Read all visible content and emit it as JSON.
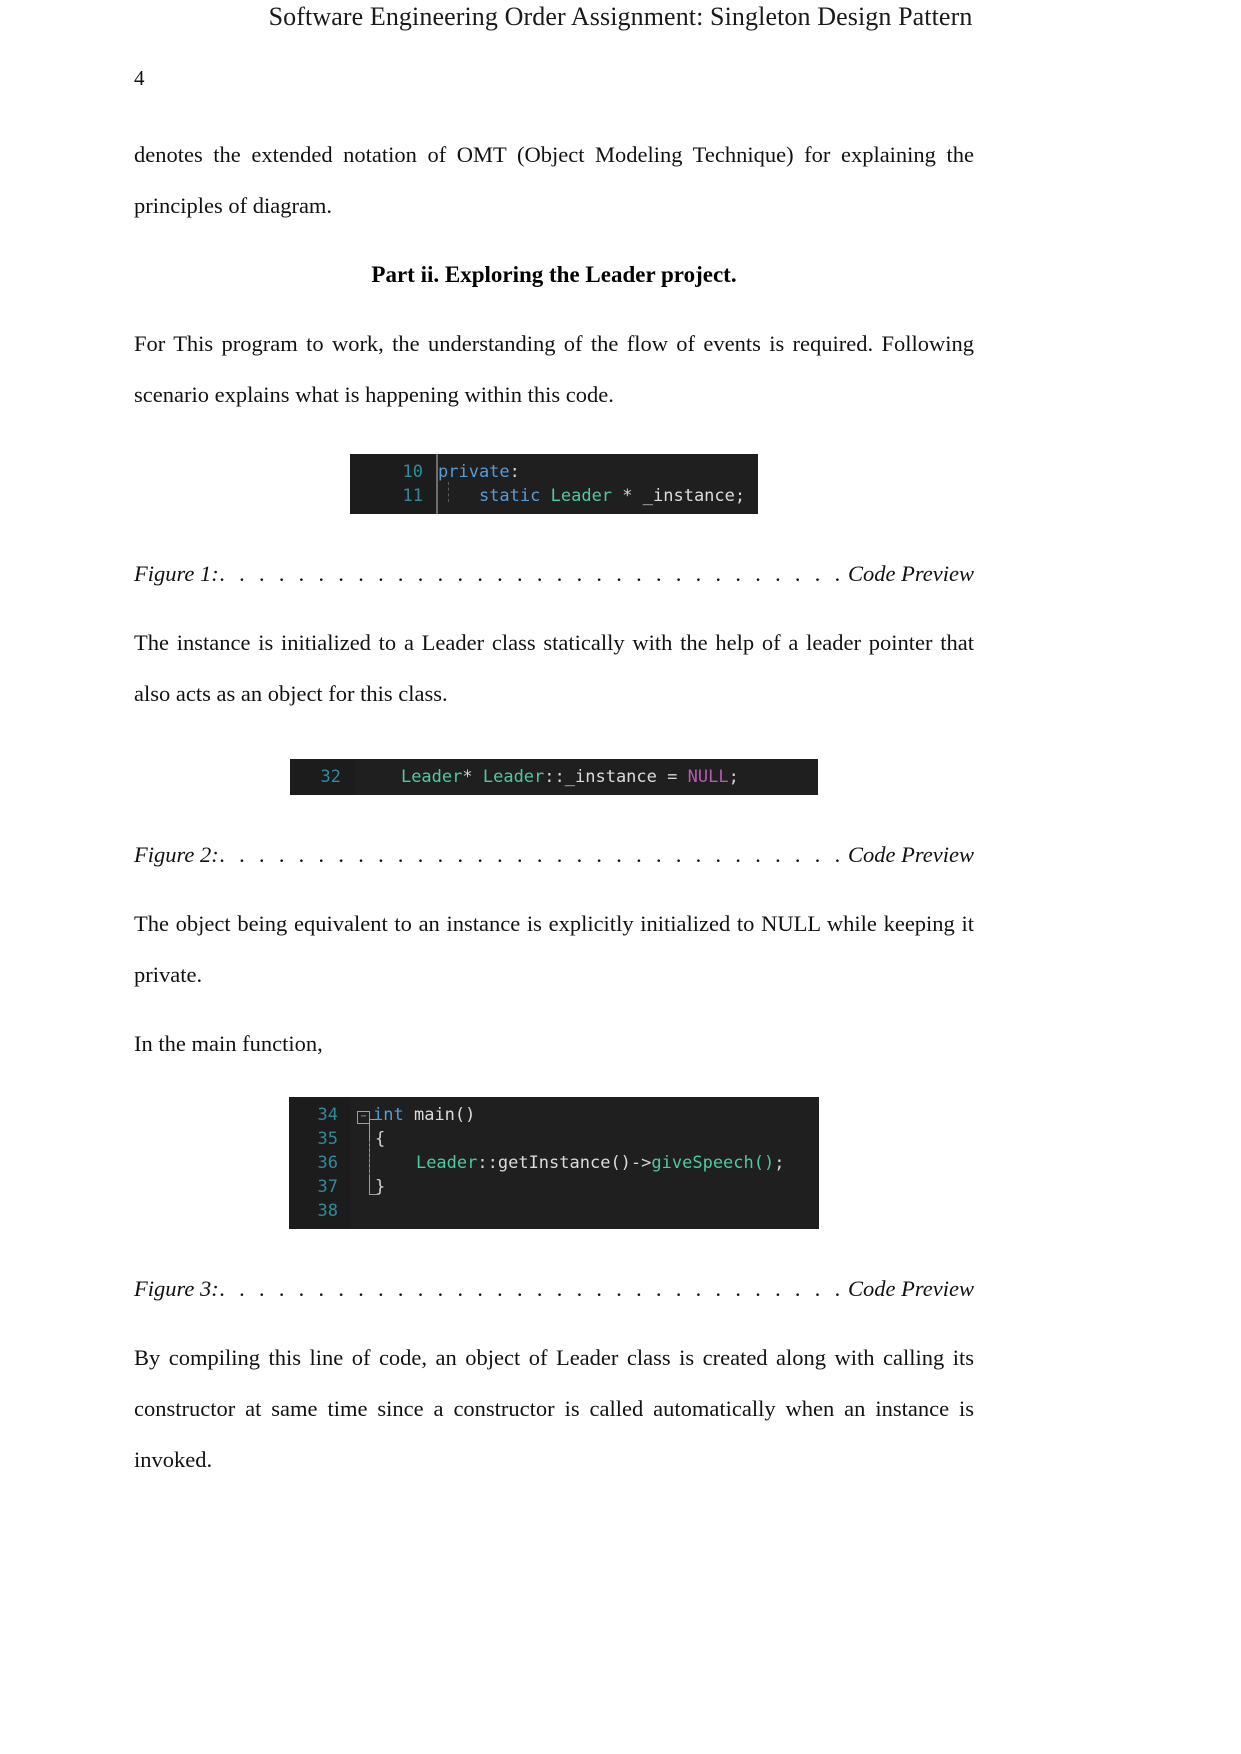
{
  "header": {
    "running_title": "Software Engineering Order Assignment:  Singleton Design Pattern"
  },
  "page": {
    "number": "4"
  },
  "body": {
    "para_1": "denotes the extended notation of OMT (Object Modeling Technique) for explaining the principles of diagram.",
    "heading_part2": "Part ii. Exploring the Leader project.",
    "para_2": "For This program to work, the understanding of the flow of events is required. Following scenario explains what is happening within this code.",
    "para_3": "The instance is initialized to a Leader class statically with the help of a leader pointer that also acts as an object for this class.",
    "para_4": "The object being equivalent to an instance is explicitly initialized to NULL while keeping it private.",
    "para_5": "In the main function,",
    "para_6": "By compiling this line of code, an object of Leader class is created along with calling its constructor at same time since a constructor is called automatically when an instance is invoked."
  },
  "captions": {
    "fig1_label": "Figure 1:",
    "fig1_leader": ". . . . . . . . . . . . . . . . . . . . . . . . . . . . . . . . . . . . . . . . . . . . . . . . . .",
    "fig1_right": "Code Preview",
    "fig2_label": "Figure 2:",
    "fig2_leader": ". . . . . . . . . . . . . . . . . . . . . . . . . . . . . . . . . . . . . . . . . . . . . . . . . .",
    "fig2_right": "Code Preview",
    "fig3_label": "Figure 3:",
    "fig3_leader": ". . . . . . . . . . . . . . . . . . . . . . . . . . . . . . . . . . . . . . . . . . . . . . . . . .",
    "fig3_right": "Code Preview"
  },
  "code_figures": {
    "figure1": {
      "line_numbers": [
        "10",
        "11"
      ],
      "lines": [
        {
          "keyword": "private",
          "punct": ":"
        },
        {
          "indent": "    ",
          "keyword": "static",
          "space1": " ",
          "type": "Leader",
          "space2": " * ",
          "var": "_instance",
          "punct": ";"
        }
      ]
    },
    "figure2": {
      "line_numbers": [
        "32"
      ],
      "lines": [
        {
          "indent": "    ",
          "type1": "Leader",
          "punct1": "* ",
          "type2": "Leader",
          "punct2": "::",
          "var": "_instance",
          "op": " = ",
          "constant": "NULL",
          "punct3": ";"
        }
      ]
    },
    "figure3": {
      "line_numbers": [
        "34",
        "35",
        "36",
        "37",
        "38"
      ],
      "fold_marker": "−",
      "lines": [
        {
          "keyword": "int",
          "space": " ",
          "fn": "main()"
        },
        {
          "text": "{"
        },
        {
          "indent": "    ",
          "type": "Leader",
          "punct1": "::",
          "fn": "getInstance()",
          "arrow": "->",
          "method": "giveSpeech()",
          "punct2": ";"
        },
        {
          "text": "}"
        },
        {
          "text": ""
        }
      ]
    }
  },
  "colors": {
    "code_background": "#1f1f1f",
    "gutter_background": "#1c1c1c",
    "line_number": "#2e8b9d",
    "keyword": "#569cd6",
    "type": "#4ec9a0",
    "constant": "#b55ab5",
    "plain_text": "#d4d4d4",
    "page_background": "#ffffff",
    "text": "#111111"
  }
}
